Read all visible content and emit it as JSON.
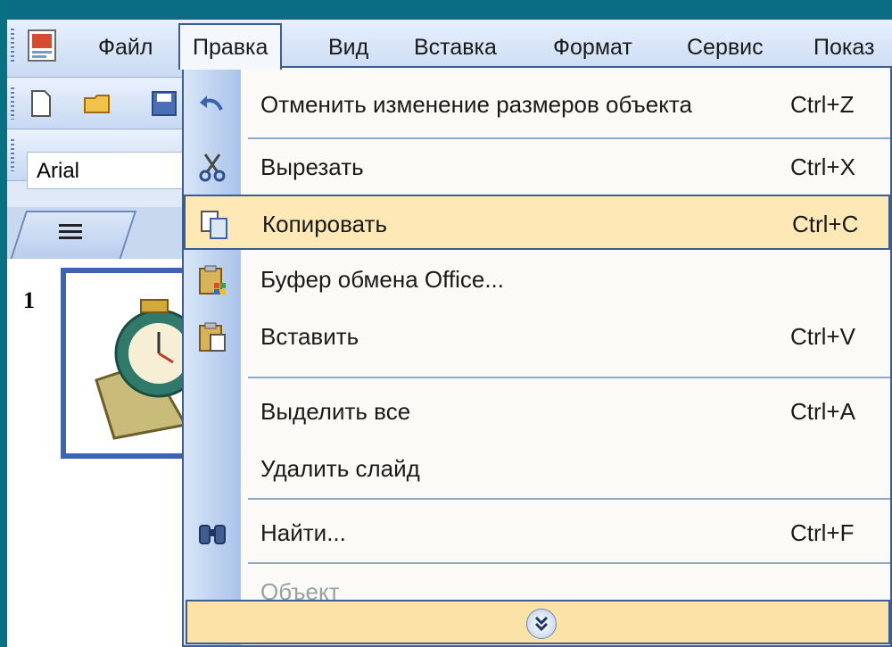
{
  "menubar": {
    "items": [
      {
        "label": "Файл"
      },
      {
        "label": "Правка"
      },
      {
        "label": "Вид"
      },
      {
        "label": "Вставка"
      },
      {
        "label": "Формат"
      },
      {
        "label": "Сервис"
      },
      {
        "label": "Показ"
      }
    ]
  },
  "toolbar": {
    "font_name": "Arial"
  },
  "slide_pane": {
    "slide_number": "1"
  },
  "edit_menu": {
    "items": [
      {
        "label": "Отменить изменение размеров объекта",
        "shortcut": "Ctrl+Z",
        "icon": "undo-icon"
      },
      {
        "label": "Вырезать",
        "shortcut": "Ctrl+X",
        "icon": "scissors-icon"
      },
      {
        "label": "Копировать",
        "shortcut": "Ctrl+C",
        "icon": "copy-icon"
      },
      {
        "label": "Буфер обмена Office...",
        "shortcut": "",
        "icon": "clipboard-office-icon"
      },
      {
        "label": "Вставить",
        "shortcut": "Ctrl+V",
        "icon": "paste-icon"
      },
      {
        "label": "Выделить все",
        "shortcut": "Ctrl+A"
      },
      {
        "label": "Удалить слайд",
        "shortcut": ""
      },
      {
        "label": "Найти...",
        "shortcut": "Ctrl+F",
        "icon": "binoculars-icon"
      },
      {
        "label": "Объект",
        "shortcut": ""
      }
    ],
    "expand_icon": "double-chevron-down-icon"
  },
  "colors": {
    "accent": "#3d5d8f",
    "highlight": "#fde8b6",
    "background": "#0b6f86"
  }
}
